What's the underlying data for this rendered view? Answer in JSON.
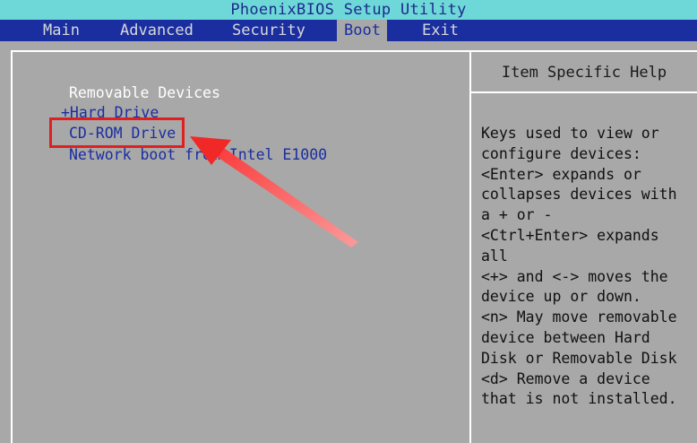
{
  "title": "PhoenixBIOS Setup Utility",
  "menu": {
    "tabs": [
      {
        "label": "Main"
      },
      {
        "label": "Advanced"
      },
      {
        "label": "Security"
      },
      {
        "label": "Boot"
      },
      {
        "label": "Exit"
      }
    ],
    "active_tab": "Boot"
  },
  "boot_list": {
    "removable": "Removable Devices",
    "hard_drive": "+Hard Drive",
    "cdrom": "CD-ROM Drive",
    "network": "Network boot from Intel E1000"
  },
  "help": {
    "title": "Item Specific Help",
    "text": "Keys used to view or\nconfigure devices:\n<Enter> expands or\ncollapses devices with\na + or -\n<Ctrl+Enter> expands\nall\n<+> and <-> moves the\ndevice up or down.\n<n> May move removable\ndevice between Hard\nDisk or Removable Disk\n<d> Remove a device\nthat is not installed."
  },
  "annotation": {
    "color": "#e02020",
    "target": "CD-ROM Drive"
  },
  "colors": {
    "title_bg": "#6ed8d8",
    "menu_bg": "#1a2ea0",
    "panel_bg": "#a8a8a8",
    "item_text": "#1a2ea0"
  }
}
